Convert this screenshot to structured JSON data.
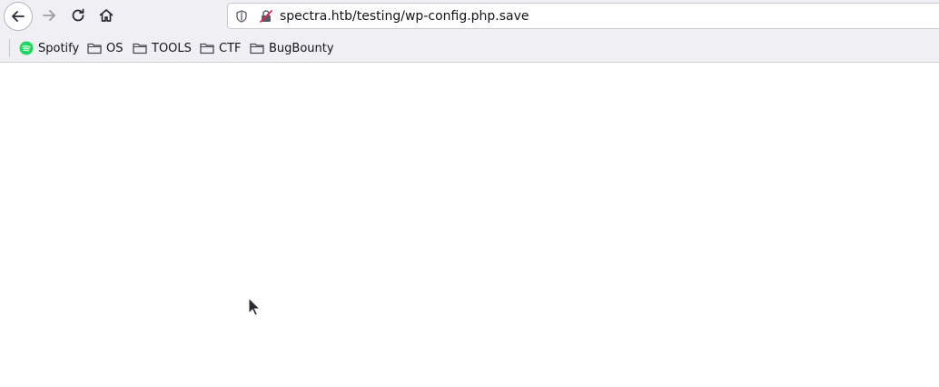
{
  "toolbar": {
    "back": "back-arrow-icon",
    "forward": "forward-arrow-icon",
    "reload": "reload-icon",
    "home": "home-icon"
  },
  "urlbar": {
    "url": "spectra.htb/testing/wp-config.php.save",
    "security_icons": [
      "shield-icon",
      "insecure-lock-icon"
    ]
  },
  "bookmarks": [
    {
      "label": "Spotify",
      "icon": "spotify-icon"
    },
    {
      "label": "OS",
      "icon": "folder-icon"
    },
    {
      "label": "TOOLS",
      "icon": "folder-icon"
    },
    {
      "label": "CTF",
      "icon": "folder-icon"
    },
    {
      "label": "BugBounty",
      "icon": "folder-icon"
    }
  ],
  "colors": {
    "chrome_bg": "#f0f0f4",
    "spotify_green": "#1ed760",
    "insecure_red": "#e22850"
  }
}
